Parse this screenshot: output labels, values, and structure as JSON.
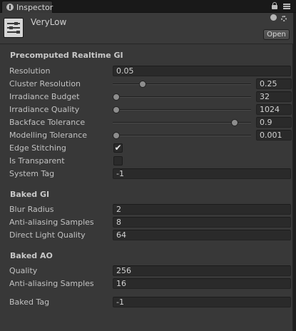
{
  "tab": {
    "label": "Inspector"
  },
  "asset": {
    "name": "VeryLow",
    "open_label": "Open"
  },
  "sections": {
    "precomputed": {
      "title": "Precomputed Realtime GI",
      "resolution": {
        "label": "Resolution",
        "value": "0.05"
      },
      "cluster_resolution": {
        "label": "Cluster Resolution",
        "value": "0.25",
        "slider_fraction": 0.2
      },
      "irradiance_budget": {
        "label": "Irradiance Budget",
        "value": "32",
        "slider_fraction": 0.0
      },
      "irradiance_quality": {
        "label": "Irradiance Quality",
        "value": "1024",
        "slider_fraction": 0.0
      },
      "backface_tolerance": {
        "label": "Backface Tolerance",
        "value": "0.9",
        "slider_fraction": 0.9
      },
      "modelling_tolerance": {
        "label": "Modelling Tolerance",
        "value": "0.001",
        "slider_fraction": 0.0
      },
      "edge_stitching": {
        "label": "Edge Stitching",
        "checked": true,
        "check_glyph": "✔"
      },
      "is_transparent": {
        "label": "Is Transparent",
        "checked": false,
        "check_glyph": ""
      },
      "system_tag": {
        "label": "System Tag",
        "value": "-1"
      }
    },
    "baked_gi": {
      "title": "Baked GI",
      "blur_radius": {
        "label": "Blur Radius",
        "value": "2"
      },
      "antialiasing_samples": {
        "label": "Anti-aliasing Samples",
        "value": "8"
      },
      "direct_light_quality": {
        "label": "Direct Light Quality",
        "value": "64"
      }
    },
    "baked_ao": {
      "title": "Baked AO",
      "quality": {
        "label": "Quality",
        "value": "256"
      },
      "antialiasing_samples": {
        "label": "Anti-aliasing Samples",
        "value": "16"
      }
    },
    "baked_tag": {
      "label": "Baked Tag",
      "value": "-1"
    }
  },
  "icons": {
    "tab": "info-icon",
    "lock": "lock-icon",
    "menu": "menu-icon",
    "help": "help-icon",
    "settings": "gear-icon",
    "asset": "lightmap-parameters-icon"
  },
  "colors": {
    "panel": "#383838",
    "field": "#2a2a2a",
    "tab_bar": "#191919"
  }
}
